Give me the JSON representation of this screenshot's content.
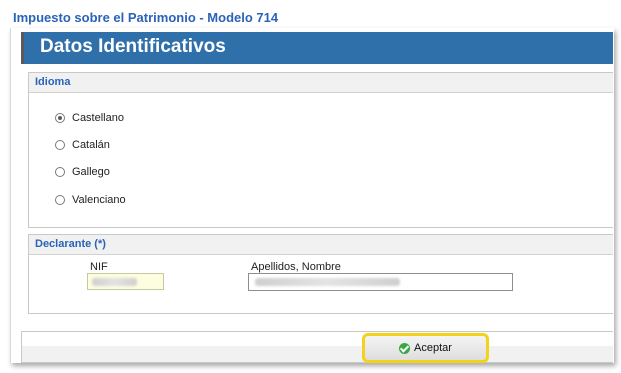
{
  "app": {
    "title": "Impuesto sobre el Patrimonio - Modelo 714"
  },
  "header": {
    "title": "Datos Identificativos"
  },
  "idioma": {
    "title": "Idioma",
    "selected": "Castellano",
    "options": [
      "Castellano",
      "Catalán",
      "Gallego",
      "Valenciano"
    ]
  },
  "declarante": {
    "title": "Declarante (*)",
    "nif_label": "NIF",
    "nombre_label": "Apellidos, Nombre",
    "nif_value": "",
    "nombre_value": ""
  },
  "footer": {
    "accept_label": "Aceptar"
  }
}
